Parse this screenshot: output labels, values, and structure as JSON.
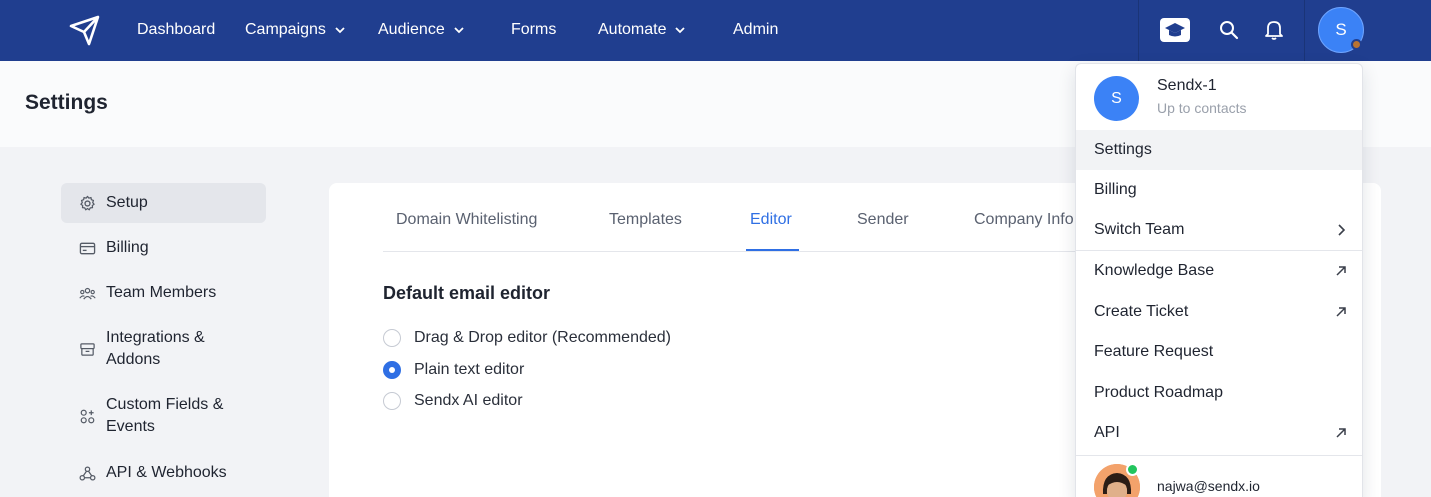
{
  "nav": {
    "items": [
      {
        "label": "Dashboard",
        "has_menu": false
      },
      {
        "label": "Campaigns",
        "has_menu": true
      },
      {
        "label": "Audience",
        "has_menu": true
      },
      {
        "label": "Forms",
        "has_menu": false
      },
      {
        "label": "Automate",
        "has_menu": true
      },
      {
        "label": "Admin",
        "has_menu": false
      }
    ],
    "avatar_letter": "S",
    "bar_color": "#203e8f"
  },
  "page": {
    "title": "Settings"
  },
  "sidebar": {
    "items": [
      {
        "label": "Setup",
        "icon": "gear-icon",
        "active": true
      },
      {
        "label": "Billing",
        "icon": "card-icon",
        "active": false
      },
      {
        "label": "Team Members",
        "icon": "team-icon",
        "active": false
      },
      {
        "label": "Integrations & Addons",
        "icon": "integrations-icon",
        "active": false
      },
      {
        "label": "Custom Fields & Events",
        "icon": "custom-fields-icon",
        "active": false
      },
      {
        "label": "API & Webhooks",
        "icon": "webhooks-icon",
        "active": false
      }
    ]
  },
  "tabs": {
    "items": [
      {
        "label": "Domain Whitelisting",
        "active": false
      },
      {
        "label": "Templates",
        "active": false
      },
      {
        "label": "Editor",
        "active": true
      },
      {
        "label": "Sender",
        "active": false
      },
      {
        "label": "Company Info",
        "active": false
      }
    ]
  },
  "editor": {
    "title": "Default email editor",
    "options": [
      {
        "label": "Drag & Drop editor (Recommended)",
        "checked": false
      },
      {
        "label": "Plain text editor",
        "checked": true
      },
      {
        "label": "Sendx AI editor",
        "checked": false
      }
    ]
  },
  "dropdown": {
    "avatar_letter": "S",
    "team_name": "Sendx-1",
    "team_sub": "Up to contacts",
    "items": [
      {
        "label": "Settings",
        "icon": ""
      },
      {
        "label": "Billing",
        "icon": ""
      },
      {
        "label": "Switch Team",
        "icon": "chevron-right-icon"
      },
      {
        "label": "Knowledge Base",
        "icon": "external-link-icon"
      },
      {
        "label": "Create Ticket",
        "icon": "external-link-icon"
      },
      {
        "label": "Feature Request",
        "icon": ""
      },
      {
        "label": "Product Roadmap",
        "icon": ""
      },
      {
        "label": "API",
        "icon": "external-link-icon"
      }
    ],
    "user_email": "najwa@sendx.io"
  },
  "colors": {
    "accent": "#2f6fe4",
    "online": "#22c55e"
  }
}
